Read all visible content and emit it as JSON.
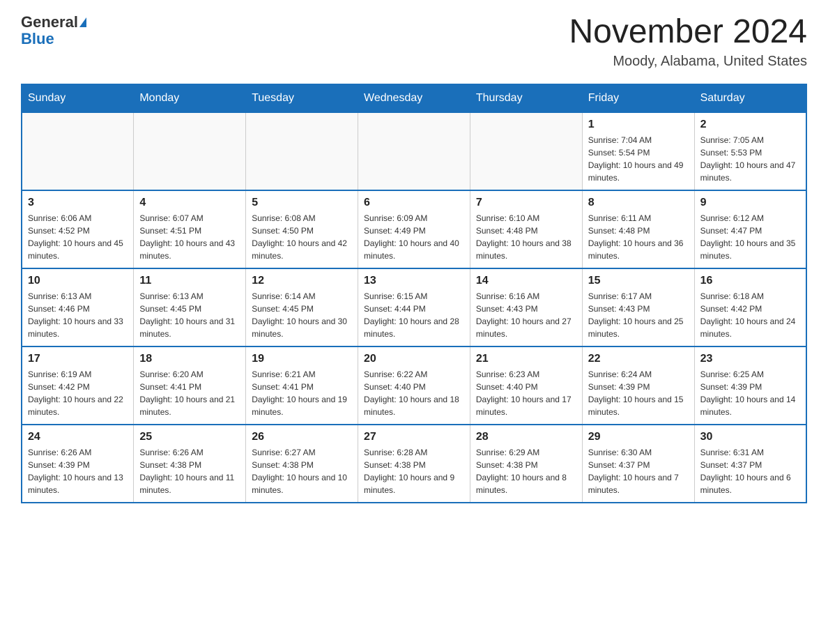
{
  "header": {
    "logo_general": "General",
    "logo_blue": "Blue",
    "month_title": "November 2024",
    "location": "Moody, Alabama, United States"
  },
  "days_of_week": [
    "Sunday",
    "Monday",
    "Tuesday",
    "Wednesday",
    "Thursday",
    "Friday",
    "Saturday"
  ],
  "weeks": [
    [
      {
        "day": "",
        "sunrise": "",
        "sunset": "",
        "daylight": ""
      },
      {
        "day": "",
        "sunrise": "",
        "sunset": "",
        "daylight": ""
      },
      {
        "day": "",
        "sunrise": "",
        "sunset": "",
        "daylight": ""
      },
      {
        "day": "",
        "sunrise": "",
        "sunset": "",
        "daylight": ""
      },
      {
        "day": "",
        "sunrise": "",
        "sunset": "",
        "daylight": ""
      },
      {
        "day": "1",
        "sunrise": "Sunrise: 7:04 AM",
        "sunset": "Sunset: 5:54 PM",
        "daylight": "Daylight: 10 hours and 49 minutes."
      },
      {
        "day": "2",
        "sunrise": "Sunrise: 7:05 AM",
        "sunset": "Sunset: 5:53 PM",
        "daylight": "Daylight: 10 hours and 47 minutes."
      }
    ],
    [
      {
        "day": "3",
        "sunrise": "Sunrise: 6:06 AM",
        "sunset": "Sunset: 4:52 PM",
        "daylight": "Daylight: 10 hours and 45 minutes."
      },
      {
        "day": "4",
        "sunrise": "Sunrise: 6:07 AM",
        "sunset": "Sunset: 4:51 PM",
        "daylight": "Daylight: 10 hours and 43 minutes."
      },
      {
        "day": "5",
        "sunrise": "Sunrise: 6:08 AM",
        "sunset": "Sunset: 4:50 PM",
        "daylight": "Daylight: 10 hours and 42 minutes."
      },
      {
        "day": "6",
        "sunrise": "Sunrise: 6:09 AM",
        "sunset": "Sunset: 4:49 PM",
        "daylight": "Daylight: 10 hours and 40 minutes."
      },
      {
        "day": "7",
        "sunrise": "Sunrise: 6:10 AM",
        "sunset": "Sunset: 4:48 PM",
        "daylight": "Daylight: 10 hours and 38 minutes."
      },
      {
        "day": "8",
        "sunrise": "Sunrise: 6:11 AM",
        "sunset": "Sunset: 4:48 PM",
        "daylight": "Daylight: 10 hours and 36 minutes."
      },
      {
        "day": "9",
        "sunrise": "Sunrise: 6:12 AM",
        "sunset": "Sunset: 4:47 PM",
        "daylight": "Daylight: 10 hours and 35 minutes."
      }
    ],
    [
      {
        "day": "10",
        "sunrise": "Sunrise: 6:13 AM",
        "sunset": "Sunset: 4:46 PM",
        "daylight": "Daylight: 10 hours and 33 minutes."
      },
      {
        "day": "11",
        "sunrise": "Sunrise: 6:13 AM",
        "sunset": "Sunset: 4:45 PM",
        "daylight": "Daylight: 10 hours and 31 minutes."
      },
      {
        "day": "12",
        "sunrise": "Sunrise: 6:14 AM",
        "sunset": "Sunset: 4:45 PM",
        "daylight": "Daylight: 10 hours and 30 minutes."
      },
      {
        "day": "13",
        "sunrise": "Sunrise: 6:15 AM",
        "sunset": "Sunset: 4:44 PM",
        "daylight": "Daylight: 10 hours and 28 minutes."
      },
      {
        "day": "14",
        "sunrise": "Sunrise: 6:16 AM",
        "sunset": "Sunset: 4:43 PM",
        "daylight": "Daylight: 10 hours and 27 minutes."
      },
      {
        "day": "15",
        "sunrise": "Sunrise: 6:17 AM",
        "sunset": "Sunset: 4:43 PM",
        "daylight": "Daylight: 10 hours and 25 minutes."
      },
      {
        "day": "16",
        "sunrise": "Sunrise: 6:18 AM",
        "sunset": "Sunset: 4:42 PM",
        "daylight": "Daylight: 10 hours and 24 minutes."
      }
    ],
    [
      {
        "day": "17",
        "sunrise": "Sunrise: 6:19 AM",
        "sunset": "Sunset: 4:42 PM",
        "daylight": "Daylight: 10 hours and 22 minutes."
      },
      {
        "day": "18",
        "sunrise": "Sunrise: 6:20 AM",
        "sunset": "Sunset: 4:41 PM",
        "daylight": "Daylight: 10 hours and 21 minutes."
      },
      {
        "day": "19",
        "sunrise": "Sunrise: 6:21 AM",
        "sunset": "Sunset: 4:41 PM",
        "daylight": "Daylight: 10 hours and 19 minutes."
      },
      {
        "day": "20",
        "sunrise": "Sunrise: 6:22 AM",
        "sunset": "Sunset: 4:40 PM",
        "daylight": "Daylight: 10 hours and 18 minutes."
      },
      {
        "day": "21",
        "sunrise": "Sunrise: 6:23 AM",
        "sunset": "Sunset: 4:40 PM",
        "daylight": "Daylight: 10 hours and 17 minutes."
      },
      {
        "day": "22",
        "sunrise": "Sunrise: 6:24 AM",
        "sunset": "Sunset: 4:39 PM",
        "daylight": "Daylight: 10 hours and 15 minutes."
      },
      {
        "day": "23",
        "sunrise": "Sunrise: 6:25 AM",
        "sunset": "Sunset: 4:39 PM",
        "daylight": "Daylight: 10 hours and 14 minutes."
      }
    ],
    [
      {
        "day": "24",
        "sunrise": "Sunrise: 6:26 AM",
        "sunset": "Sunset: 4:39 PM",
        "daylight": "Daylight: 10 hours and 13 minutes."
      },
      {
        "day": "25",
        "sunrise": "Sunrise: 6:26 AM",
        "sunset": "Sunset: 4:38 PM",
        "daylight": "Daylight: 10 hours and 11 minutes."
      },
      {
        "day": "26",
        "sunrise": "Sunrise: 6:27 AM",
        "sunset": "Sunset: 4:38 PM",
        "daylight": "Daylight: 10 hours and 10 minutes."
      },
      {
        "day": "27",
        "sunrise": "Sunrise: 6:28 AM",
        "sunset": "Sunset: 4:38 PM",
        "daylight": "Daylight: 10 hours and 9 minutes."
      },
      {
        "day": "28",
        "sunrise": "Sunrise: 6:29 AM",
        "sunset": "Sunset: 4:38 PM",
        "daylight": "Daylight: 10 hours and 8 minutes."
      },
      {
        "day": "29",
        "sunrise": "Sunrise: 6:30 AM",
        "sunset": "Sunset: 4:37 PM",
        "daylight": "Daylight: 10 hours and 7 minutes."
      },
      {
        "day": "30",
        "sunrise": "Sunrise: 6:31 AM",
        "sunset": "Sunset: 4:37 PM",
        "daylight": "Daylight: 10 hours and 6 minutes."
      }
    ]
  ]
}
